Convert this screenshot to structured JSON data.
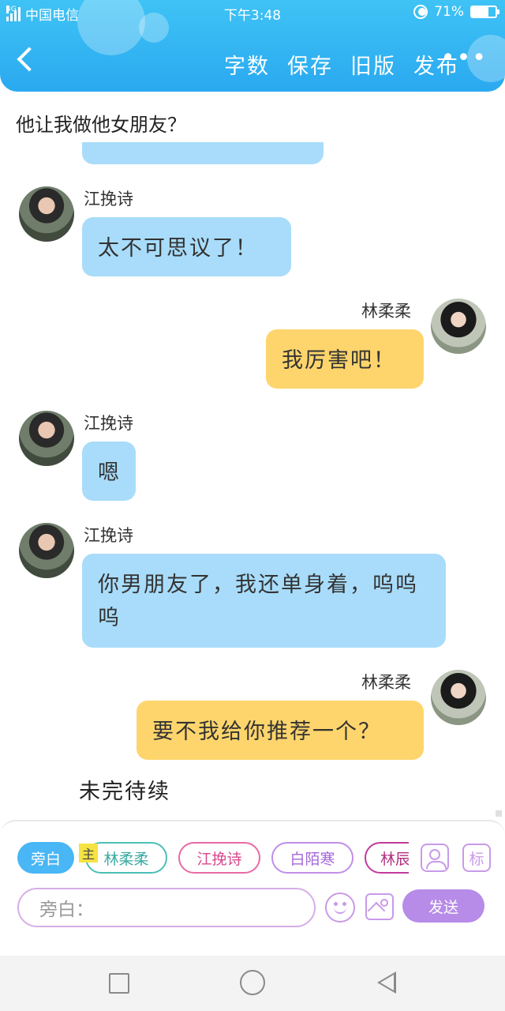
{
  "status_bar": {
    "network": "4G",
    "carrier": "中国电信",
    "time": "下午3:48",
    "battery": "71%",
    "battery_level": 0.71
  },
  "header": {
    "back_icon": "chevron-left-icon",
    "menu": [
      "字数",
      "保存",
      "旧版",
      "发布"
    ],
    "more": "•••"
  },
  "chat": {
    "title": "他让我做他女朋友？",
    "messages": [
      {
        "side": "left",
        "sender": "江挽诗",
        "text": "太不可思议了！"
      },
      {
        "side": "right",
        "sender": "林柔柔",
        "text": "我厉害吧！"
      },
      {
        "side": "left",
        "sender": "江挽诗",
        "text": "嗯"
      },
      {
        "side": "left",
        "sender": "江挽诗",
        "text": "你男朋友了，我还单身着，呜呜呜"
      },
      {
        "side": "right",
        "sender": "林柔柔",
        "text": "要不我给你推荐一个？"
      }
    ],
    "continued": "未完待续"
  },
  "composer": {
    "chips": [
      "旁白",
      "林柔柔",
      "江挽诗",
      "白陌寒",
      "林辰"
    ],
    "chip_tag": "主",
    "label_button": "标",
    "input_placeholder": "旁白：",
    "send_label": "发送",
    "colors": {
      "active": "#49b6f5",
      "teal": "#4bbfb5",
      "pink": "#e86aa4",
      "purple": "#c08ee8",
      "magenta": "#c23a9a",
      "send": "#b78be8"
    }
  },
  "colors": {
    "header": "#2aa9f0",
    "left_bubble": "#a8dcfa",
    "right_bubble": "#fdd56c"
  }
}
